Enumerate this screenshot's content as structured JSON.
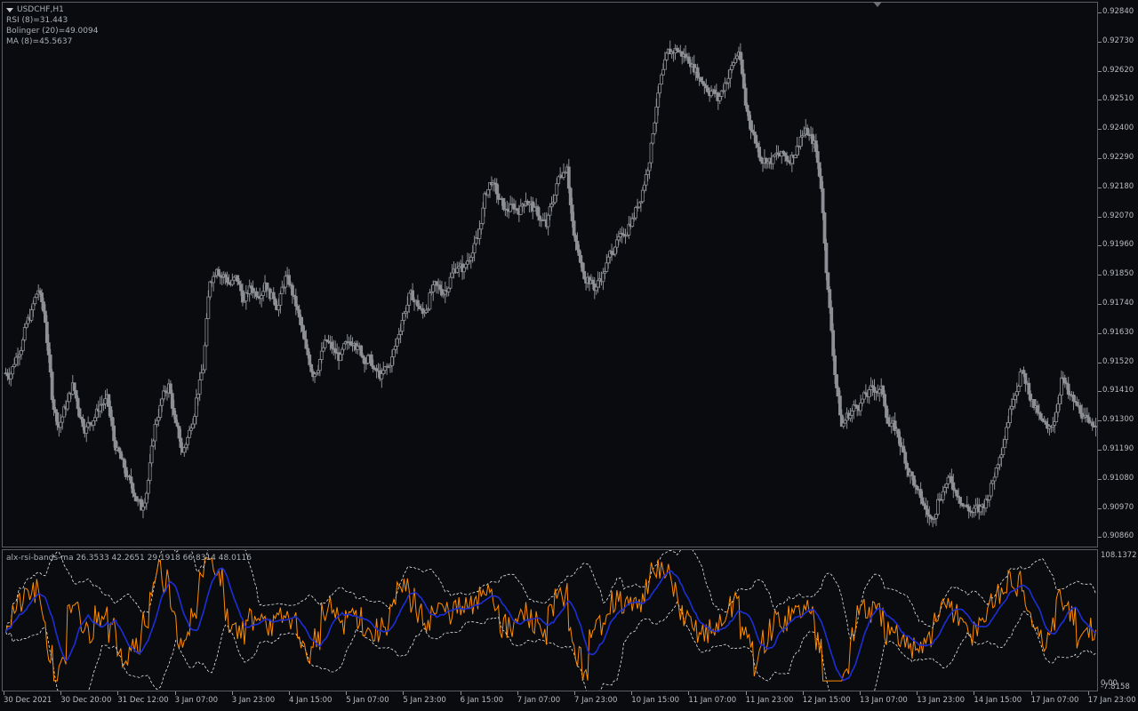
{
  "chart": {
    "symbol": "USDCHF,H1",
    "indicators": [
      {
        "label": "RSI (8)=31.443"
      },
      {
        "label": "Bolinger (20)=49.0094"
      },
      {
        "label": "MA (8)=45.5637"
      }
    ],
    "price_axis": [
      "0.92840",
      "0.92730",
      "0.92620",
      "0.92510",
      "0.92400",
      "0.92290",
      "0.92180",
      "0.92070",
      "0.91960",
      "0.91850",
      "0.91740",
      "0.91630",
      "0.91520",
      "0.91410",
      "0.91300",
      "0.91190",
      "0.91080",
      "0.90970",
      "0.90860"
    ],
    "colors": {
      "background": "#0a0b0f",
      "candle": "#8c8f94",
      "rsi": "#ff8c00",
      "ma": "#1c2fd6",
      "bands": "#e8e8e8"
    }
  },
  "subwindow": {
    "title": "alx-rsi-bands-ma 26.3533 42.2651 29.1918 66.8314 48.0116",
    "axis_top": "108.1372",
    "axis_zero": "0.00",
    "axis_bottom": "-7.8158"
  },
  "time_axis": [
    "30 Dec 2021",
    "30 Dec 20:00",
    "31 Dec 12:00",
    "3 Jan 07:00",
    "3 Jan 23:00",
    "4 Jan 15:00",
    "5 Jan 07:00",
    "5 Jan 23:00",
    "6 Jan 15:00",
    "7 Jan 07:00",
    "7 Jan 23:00",
    "10 Jan 15:00",
    "11 Jan 07:00",
    "11 Jan 23:00",
    "12 Jan 15:00",
    "13 Jan 07:00",
    "13 Jan 23:00",
    "14 Jan 15:00",
    "17 Jan 07:00",
    "17 Jan 23:00"
  ],
  "chart_data": {
    "type": "line",
    "xlabel": "",
    "ylabel": "",
    "ylim": [
      0.9086,
      0.9284
    ],
    "series": [
      {
        "values": [
          0.915,
          0.9158,
          0.9165,
          0.9172,
          0.9181,
          0.917,
          0.9142,
          0.913,
          0.9138,
          0.9145,
          0.9135,
          0.9129,
          0.9133,
          0.9138,
          0.914,
          0.9125,
          0.9118,
          0.911,
          0.9105,
          0.91,
          0.911,
          0.913,
          0.914,
          0.9145,
          0.913,
          0.912,
          0.9128,
          0.914,
          0.9152,
          0.9185,
          0.919,
          0.9186,
          0.9183,
          0.9185,
          0.9176,
          0.9182,
          0.918,
          0.9184,
          0.9178,
          0.9175,
          0.9185,
          0.918,
          0.917,
          0.9158,
          0.915,
          0.9155,
          0.9162,
          0.9158,
          0.9155,
          0.916,
          0.9163,
          0.9158,
          0.9155,
          0.915,
          0.9148,
          0.9152,
          0.916,
          0.917,
          0.9178,
          0.9176,
          0.9172,
          0.9178,
          0.9182,
          0.918,
          0.9185,
          0.919,
          0.9188,
          0.9195,
          0.92,
          0.9215,
          0.9222,
          0.9215,
          0.921,
          0.9212,
          0.9211,
          0.9215,
          0.9212,
          0.9208,
          0.9205,
          0.9215,
          0.9225,
          0.9228,
          0.92,
          0.919,
          0.9185,
          0.9182,
          0.9186,
          0.9192,
          0.9198,
          0.92,
          0.9205,
          0.921,
          0.9218,
          0.923,
          0.925,
          0.9262,
          0.927,
          0.9271,
          0.9268,
          0.9266,
          0.9262,
          0.9258,
          0.9255,
          0.9252,
          0.9258,
          0.9264,
          0.927,
          0.925,
          0.924,
          0.9232,
          0.923,
          0.9229,
          0.9231,
          0.923,
          0.9232,
          0.9238,
          0.924,
          0.9235,
          0.922,
          0.918,
          0.915,
          0.913,
          0.9135,
          0.9138,
          0.914,
          0.9142,
          0.9144,
          0.9143,
          0.913,
          0.9128,
          0.912,
          0.9112,
          0.9105,
          0.91,
          0.9095,
          0.9102,
          0.9108,
          0.911,
          0.9105,
          0.91,
          0.9098,
          0.9099,
          0.9102,
          0.911,
          0.912,
          0.913,
          0.9142,
          0.915,
          0.9145,
          0.9138,
          0.9132,
          0.9128,
          0.9133,
          0.9148,
          0.9142,
          0.9138,
          0.9135,
          0.913,
          0.9132
        ]
      }
    ]
  }
}
